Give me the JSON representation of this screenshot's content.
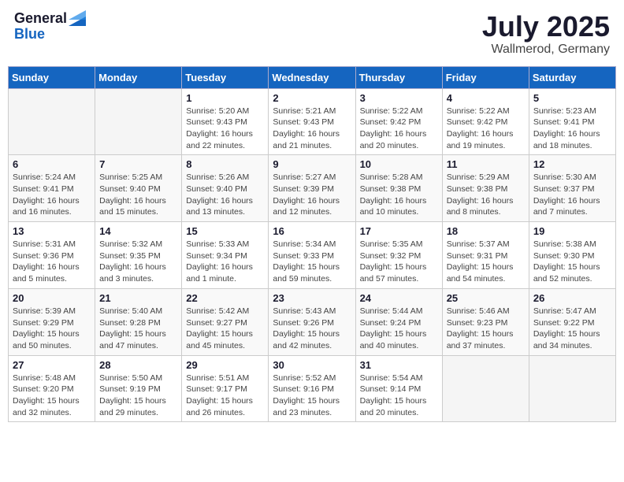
{
  "header": {
    "logo_general": "General",
    "logo_blue": "Blue",
    "month": "July 2025",
    "location": "Wallmerod, Germany"
  },
  "weekdays": [
    "Sunday",
    "Monday",
    "Tuesday",
    "Wednesday",
    "Thursday",
    "Friday",
    "Saturday"
  ],
  "weeks": [
    [
      {
        "day": "",
        "detail": ""
      },
      {
        "day": "",
        "detail": ""
      },
      {
        "day": "1",
        "detail": "Sunrise: 5:20 AM\nSunset: 9:43 PM\nDaylight: 16 hours\nand 22 minutes."
      },
      {
        "day": "2",
        "detail": "Sunrise: 5:21 AM\nSunset: 9:43 PM\nDaylight: 16 hours\nand 21 minutes."
      },
      {
        "day": "3",
        "detail": "Sunrise: 5:22 AM\nSunset: 9:42 PM\nDaylight: 16 hours\nand 20 minutes."
      },
      {
        "day": "4",
        "detail": "Sunrise: 5:22 AM\nSunset: 9:42 PM\nDaylight: 16 hours\nand 19 minutes."
      },
      {
        "day": "5",
        "detail": "Sunrise: 5:23 AM\nSunset: 9:41 PM\nDaylight: 16 hours\nand 18 minutes."
      }
    ],
    [
      {
        "day": "6",
        "detail": "Sunrise: 5:24 AM\nSunset: 9:41 PM\nDaylight: 16 hours\nand 16 minutes."
      },
      {
        "day": "7",
        "detail": "Sunrise: 5:25 AM\nSunset: 9:40 PM\nDaylight: 16 hours\nand 15 minutes."
      },
      {
        "day": "8",
        "detail": "Sunrise: 5:26 AM\nSunset: 9:40 PM\nDaylight: 16 hours\nand 13 minutes."
      },
      {
        "day": "9",
        "detail": "Sunrise: 5:27 AM\nSunset: 9:39 PM\nDaylight: 16 hours\nand 12 minutes."
      },
      {
        "day": "10",
        "detail": "Sunrise: 5:28 AM\nSunset: 9:38 PM\nDaylight: 16 hours\nand 10 minutes."
      },
      {
        "day": "11",
        "detail": "Sunrise: 5:29 AM\nSunset: 9:38 PM\nDaylight: 16 hours\nand 8 minutes."
      },
      {
        "day": "12",
        "detail": "Sunrise: 5:30 AM\nSunset: 9:37 PM\nDaylight: 16 hours\nand 7 minutes."
      }
    ],
    [
      {
        "day": "13",
        "detail": "Sunrise: 5:31 AM\nSunset: 9:36 PM\nDaylight: 16 hours\nand 5 minutes."
      },
      {
        "day": "14",
        "detail": "Sunrise: 5:32 AM\nSunset: 9:35 PM\nDaylight: 16 hours\nand 3 minutes."
      },
      {
        "day": "15",
        "detail": "Sunrise: 5:33 AM\nSunset: 9:34 PM\nDaylight: 16 hours\nand 1 minute."
      },
      {
        "day": "16",
        "detail": "Sunrise: 5:34 AM\nSunset: 9:33 PM\nDaylight: 15 hours\nand 59 minutes."
      },
      {
        "day": "17",
        "detail": "Sunrise: 5:35 AM\nSunset: 9:32 PM\nDaylight: 15 hours\nand 57 minutes."
      },
      {
        "day": "18",
        "detail": "Sunrise: 5:37 AM\nSunset: 9:31 PM\nDaylight: 15 hours\nand 54 minutes."
      },
      {
        "day": "19",
        "detail": "Sunrise: 5:38 AM\nSunset: 9:30 PM\nDaylight: 15 hours\nand 52 minutes."
      }
    ],
    [
      {
        "day": "20",
        "detail": "Sunrise: 5:39 AM\nSunset: 9:29 PM\nDaylight: 15 hours\nand 50 minutes."
      },
      {
        "day": "21",
        "detail": "Sunrise: 5:40 AM\nSunset: 9:28 PM\nDaylight: 15 hours\nand 47 minutes."
      },
      {
        "day": "22",
        "detail": "Sunrise: 5:42 AM\nSunset: 9:27 PM\nDaylight: 15 hours\nand 45 minutes."
      },
      {
        "day": "23",
        "detail": "Sunrise: 5:43 AM\nSunset: 9:26 PM\nDaylight: 15 hours\nand 42 minutes."
      },
      {
        "day": "24",
        "detail": "Sunrise: 5:44 AM\nSunset: 9:24 PM\nDaylight: 15 hours\nand 40 minutes."
      },
      {
        "day": "25",
        "detail": "Sunrise: 5:46 AM\nSunset: 9:23 PM\nDaylight: 15 hours\nand 37 minutes."
      },
      {
        "day": "26",
        "detail": "Sunrise: 5:47 AM\nSunset: 9:22 PM\nDaylight: 15 hours\nand 34 minutes."
      }
    ],
    [
      {
        "day": "27",
        "detail": "Sunrise: 5:48 AM\nSunset: 9:20 PM\nDaylight: 15 hours\nand 32 minutes."
      },
      {
        "day": "28",
        "detail": "Sunrise: 5:50 AM\nSunset: 9:19 PM\nDaylight: 15 hours\nand 29 minutes."
      },
      {
        "day": "29",
        "detail": "Sunrise: 5:51 AM\nSunset: 9:17 PM\nDaylight: 15 hours\nand 26 minutes."
      },
      {
        "day": "30",
        "detail": "Sunrise: 5:52 AM\nSunset: 9:16 PM\nDaylight: 15 hours\nand 23 minutes."
      },
      {
        "day": "31",
        "detail": "Sunrise: 5:54 AM\nSunset: 9:14 PM\nDaylight: 15 hours\nand 20 minutes."
      },
      {
        "day": "",
        "detail": ""
      },
      {
        "day": "",
        "detail": ""
      }
    ]
  ]
}
